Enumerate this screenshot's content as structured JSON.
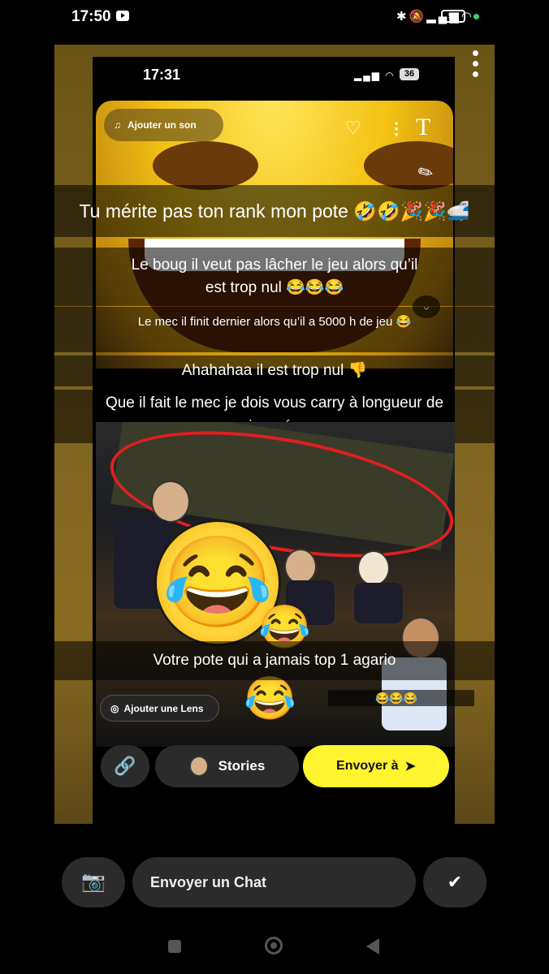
{
  "status_bar": {
    "time": "17:50",
    "battery": "52"
  },
  "inner_status": {
    "time": "17:31",
    "battery": "36"
  },
  "editor": {
    "add_sound_label": "Ajouter un son",
    "text_tool_label": "T"
  },
  "captions": {
    "top": "Tu mérite pas ton rank mon pote 🤣🤣🎉🎉🚅",
    "second": "Le boug il veut pas lâcher le jeu alors qu’il est trop nul 😂😂😂",
    "third": "Le mec il finit dernier alors qu’il a 5000 h de jeu 😂",
    "fourth": "Ahahahaa il est trop nul 👎",
    "fifth": "Que il fait le mec je dois vous carry à longueur de journée",
    "sixth": "Votre pote qui a jamais top 1 agario",
    "small": "😂😂😂"
  },
  "lens": {
    "label": "Ajouter une Lens"
  },
  "actions": {
    "stories_label": "Stories",
    "send_label": "Envoyer à"
  },
  "chat": {
    "placeholder": "Envoyer un Chat"
  },
  "icons": [
    "video-icon",
    "bluetooth-icon",
    "mute-icon",
    "signal-icon",
    "wifi-icon",
    "battery-icon",
    "music-note-icon",
    "heart-icon",
    "more-icon",
    "pencil-icon",
    "chevron-down-icon",
    "lens-icon",
    "link-icon",
    "send-arrow-icon",
    "camera-icon",
    "snap-chat-icon"
  ],
  "colors": {
    "send_button": "#fff42d",
    "scribble": "#e02020",
    "online_dot": "#3bd16f"
  }
}
